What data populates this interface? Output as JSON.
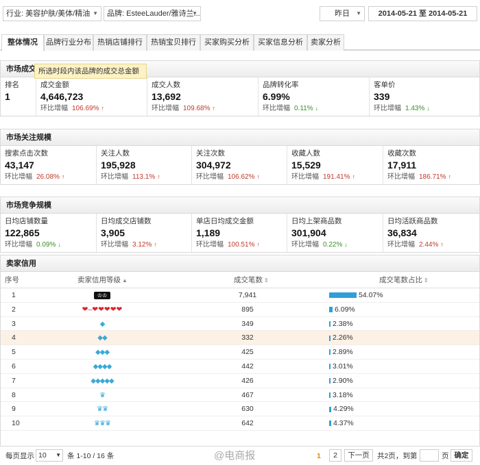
{
  "filters": {
    "industry": "行业: 美容护肤/美体/精油",
    "brand": "品牌: EsteeLauder/雅诗兰...",
    "period": "昨日",
    "date_range": "2014-05-21 至 2014-05-21"
  },
  "tabs": [
    "整体情况",
    "品牌行业分布",
    "热销店铺排行",
    "热销宝贝排行",
    "买家购买分析",
    "买家信息分析",
    "卖家分析"
  ],
  "tooltip": "所选时段内该品牌的成交总金额",
  "market_deal": {
    "title": "市场成交",
    "rank_label": "排名",
    "rank_value": "1",
    "metrics": [
      {
        "label": "成交金额",
        "value": "4,646,723",
        "change_label": "环比增幅",
        "change": "106.69%",
        "dir": "up"
      },
      {
        "label": "成交人数",
        "value": "13,692",
        "change_label": "环比增幅",
        "change": "109.68%",
        "dir": "up"
      },
      {
        "label": "品牌转化率",
        "value": "6.99%",
        "change_label": "环比增幅",
        "change": "0.11%",
        "dir": "down"
      },
      {
        "label": "客单价",
        "value": "339",
        "change_label": "环比增幅",
        "change": "1.43%",
        "dir": "down"
      }
    ]
  },
  "market_attention": {
    "title": "市场关注规模",
    "metrics": [
      {
        "label": "搜索点击次数",
        "value": "43,147",
        "change_label": "环比增幅",
        "change": "26.08%",
        "dir": "up"
      },
      {
        "label": "关注人数",
        "value": "195,928",
        "change_label": "环比增幅",
        "change": "113.1%",
        "dir": "up"
      },
      {
        "label": "关注次数",
        "value": "304,972",
        "change_label": "环比增幅",
        "change": "106.62%",
        "dir": "up"
      },
      {
        "label": "收藏人数",
        "value": "15,529",
        "change_label": "环比增幅",
        "change": "191.41%",
        "dir": "up"
      },
      {
        "label": "收藏次数",
        "value": "17,911",
        "change_label": "环比增幅",
        "change": "186.71%",
        "dir": "up"
      }
    ]
  },
  "market_competition": {
    "title": "市场竞争规模",
    "metrics": [
      {
        "label": "日均店铺数量",
        "value": "122,865",
        "change_label": "环比增幅",
        "change": "0.09%",
        "dir": "down"
      },
      {
        "label": "日均成交店铺数",
        "value": "3,905",
        "change_label": "环比增幅",
        "change": "3.12%",
        "dir": "up"
      },
      {
        "label": "单店日均成交金额",
        "value": "1,189",
        "change_label": "环比增幅",
        "change": "100.51%",
        "dir": "up"
      },
      {
        "label": "日均上架商品数",
        "value": "301,904",
        "change_label": "环比增幅",
        "change": "0.22%",
        "dir": "down"
      },
      {
        "label": "日均活跃商品数",
        "value": "36,834",
        "change_label": "环比增幅",
        "change": "2.44%",
        "dir": "up"
      }
    ]
  },
  "seller_credit": {
    "title": "卖家信用",
    "columns": [
      "序号",
      "卖家信用等级",
      "成交笔数",
      "成交笔数占比"
    ],
    "rows": [
      {
        "idx": "1",
        "level": "crown-black",
        "count": "7,941",
        "share": "54.07%",
        "share_num": 54.07
      },
      {
        "idx": "2",
        "level": "hearts",
        "count": "895",
        "share": "6.09%",
        "share_num": 6.09
      },
      {
        "idx": "3",
        "level": "diamond-1",
        "count": "349",
        "share": "2.38%",
        "share_num": 2.38
      },
      {
        "idx": "4",
        "level": "diamond-2",
        "count": "332",
        "share": "2.26%",
        "share_num": 2.26
      },
      {
        "idx": "5",
        "level": "diamond-3",
        "count": "425",
        "share": "2.89%",
        "share_num": 2.89
      },
      {
        "idx": "6",
        "level": "diamond-4",
        "count": "442",
        "share": "3.01%",
        "share_num": 3.01
      },
      {
        "idx": "7",
        "level": "diamond-5",
        "count": "426",
        "share": "2.90%",
        "share_num": 2.9
      },
      {
        "idx": "8",
        "level": "crown-1",
        "count": "467",
        "share": "3.18%",
        "share_num": 3.18
      },
      {
        "idx": "9",
        "level": "crown-2",
        "count": "630",
        "share": "4.29%",
        "share_num": 4.29
      },
      {
        "idx": "10",
        "level": "crown-3",
        "count": "642",
        "share": "4.37%",
        "share_num": 4.37
      }
    ]
  },
  "pager": {
    "per_page_label": "每页显示",
    "per_page_value": "10",
    "range_text": "条 1-10 / 16 条",
    "page1": "1",
    "page2": "2",
    "next": "下一页",
    "total_pages": "共2页，到第",
    "page_unit": "页",
    "confirm": "确定"
  },
  "watermark": "@电商报",
  "colors": {
    "up": "#c0392b",
    "down": "#3a8e27",
    "bar": "#2e9fd8",
    "tooltip_bg": "#fdf2c6"
  }
}
